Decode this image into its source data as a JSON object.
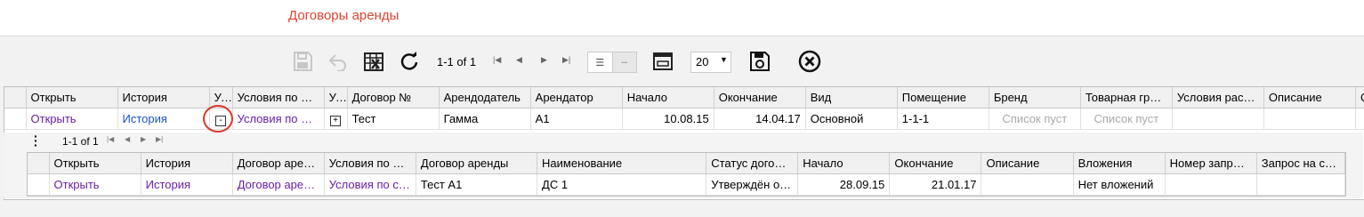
{
  "page_title": "Договоры аренды",
  "toolbar": {
    "pager_text": "1-1 of 1",
    "page_size": "20",
    "icons": [
      "save-icon",
      "undo-icon",
      "spreadsheet-icon",
      "refresh-icon",
      "first-page-icon",
      "prev-page-icon",
      "next-page-icon",
      "last-page-icon",
      "view-list-icon",
      "view-compact-icon",
      "panel-icon",
      "page-size-dropdown",
      "save-settings-icon",
      "close-icon"
    ]
  },
  "main_grid": {
    "headers": [
      "Открыть",
      "История",
      "Усл",
      "Условия по …",
      "Усл",
      "Договор №",
      "Арендодатель",
      "Арендатор",
      "Начало",
      "Окончание",
      "Вид",
      "Помещение",
      "Бренд",
      "Товарная гр…",
      "Условия рас…",
      "Описание",
      "О"
    ],
    "row": {
      "open": "Открыть",
      "history": "История",
      "expander": "-",
      "conditions": "Условия по д…",
      "expander2": "+",
      "contract_no": "Тест",
      "landlord": "Гамма",
      "tenant": "А1",
      "start": "10.08.15",
      "end": "14.04.17",
      "kind": "Основной",
      "premises": "1-1-1",
      "brand": "Список пуст",
      "product_group": "Список пуст",
      "calc_conditions": "",
      "description": "",
      "o": ""
    }
  },
  "sub_grid": {
    "pager_text": "1-1 of 1",
    "headers": [
      "Открыть",
      "История",
      "Договор аре…",
      "Условия по …",
      "Договор аренды",
      "Наименование",
      "Статус дого…",
      "Начало",
      "Окончание",
      "Описание",
      "Вложения",
      "Номер запр…",
      "Запрос на ск…"
    ],
    "row": {
      "open": "Открыть",
      "history": "История",
      "contract": "Договор аре…",
      "conditions": "Условия по с…",
      "lease": "Тест А1",
      "name": "ДС 1",
      "status": "Утверждён о…",
      "start": "28.09.15",
      "end": "21.01.17",
      "description": "",
      "attachments": "Нет вложений",
      "request_no": "",
      "request": ""
    }
  }
}
